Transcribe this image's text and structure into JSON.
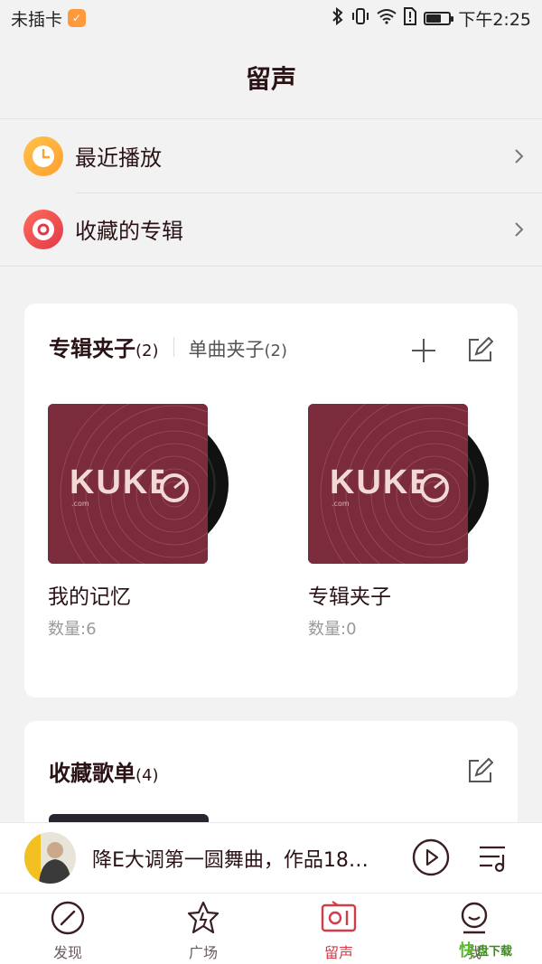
{
  "status_bar": {
    "carrier": "未插卡",
    "time": "下午2:25",
    "battery_level": 0.65
  },
  "page_title": "留声",
  "quick_list": [
    {
      "label": "最近播放",
      "icon": "clock-icon",
      "color": "#ffb03a"
    },
    {
      "label": "收藏的专辑",
      "icon": "vinyl-icon",
      "color": "#ef4b50"
    }
  ],
  "folders_card": {
    "tab_active": {
      "label": "专辑夹子",
      "count": "(2)"
    },
    "tab_other": {
      "label": "单曲夹子",
      "count": "(2)"
    },
    "folders": [
      {
        "name": "我的记忆",
        "count": "数量:6",
        "cover_brand": "KUKE",
        "cover_sub": ".com"
      },
      {
        "name": "专辑夹子",
        "count": "数量:0",
        "cover_brand": "KUKE",
        "cover_sub": ".com"
      }
    ]
  },
  "playlists_card": {
    "title": "收藏歌单",
    "count": "(4)"
  },
  "player": {
    "title": "降E大调第一圆舞曲，作品18…"
  },
  "tab_bar": [
    {
      "label": "发现",
      "icon": "compass-icon",
      "active": false
    },
    {
      "label": "广场",
      "icon": "star-icon",
      "active": false
    },
    {
      "label": "留声",
      "icon": "radio-icon",
      "active": true
    },
    {
      "label": "我",
      "icon": "user-icon",
      "active": false
    }
  ],
  "watermark": {
    "glyph": "快",
    "text": "盘下载"
  },
  "colors": {
    "accent": "#d23b48",
    "title": "#2a1215",
    "cover": "#7a2b3c"
  }
}
